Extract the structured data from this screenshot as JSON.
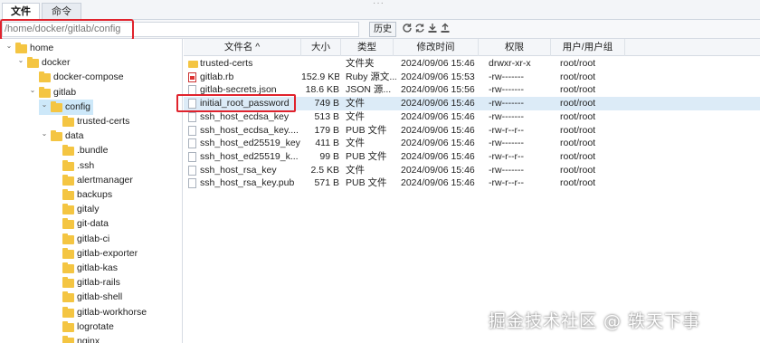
{
  "tabs": [
    {
      "label": "文件",
      "active": true
    },
    {
      "label": "命令",
      "active": false
    }
  ],
  "top_dots": "···",
  "pathbar": {
    "path": "/home/docker/gitlab/config",
    "history_label": "历史",
    "icons": [
      "refresh-icon",
      "sync-icon",
      "download-icon",
      "upload-icon"
    ]
  },
  "tree": [
    {
      "label": "home",
      "level": 0,
      "expanded": true,
      "selected": false
    },
    {
      "label": "docker",
      "level": 1,
      "expanded": true,
      "selected": false
    },
    {
      "label": "docker-compose",
      "level": 2,
      "expanded": false,
      "selected": false
    },
    {
      "label": "gitlab",
      "level": 2,
      "expanded": true,
      "selected": false
    },
    {
      "label": "config",
      "level": 3,
      "expanded": true,
      "selected": true
    },
    {
      "label": "trusted-certs",
      "level": 4,
      "expanded": false,
      "selected": false
    },
    {
      "label": "data",
      "level": 3,
      "expanded": true,
      "selected": false
    },
    {
      "label": ".bundle",
      "level": 4,
      "expanded": false,
      "selected": false
    },
    {
      "label": ".ssh",
      "level": 4,
      "expanded": false,
      "selected": false
    },
    {
      "label": "alertmanager",
      "level": 4,
      "expanded": false,
      "selected": false
    },
    {
      "label": "backups",
      "level": 4,
      "expanded": false,
      "selected": false
    },
    {
      "label": "gitaly",
      "level": 4,
      "expanded": false,
      "selected": false
    },
    {
      "label": "git-data",
      "level": 4,
      "expanded": false,
      "selected": false
    },
    {
      "label": "gitlab-ci",
      "level": 4,
      "expanded": false,
      "selected": false
    },
    {
      "label": "gitlab-exporter",
      "level": 4,
      "expanded": false,
      "selected": false
    },
    {
      "label": "gitlab-kas",
      "level": 4,
      "expanded": false,
      "selected": false
    },
    {
      "label": "gitlab-rails",
      "level": 4,
      "expanded": false,
      "selected": false
    },
    {
      "label": "gitlab-shell",
      "level": 4,
      "expanded": false,
      "selected": false
    },
    {
      "label": "gitlab-workhorse",
      "level": 4,
      "expanded": false,
      "selected": false
    },
    {
      "label": "logrotate",
      "level": 4,
      "expanded": false,
      "selected": false
    },
    {
      "label": "nginx",
      "level": 4,
      "expanded": false,
      "selected": false
    }
  ],
  "columns": {
    "name": "文件名 ^",
    "size": "大小",
    "type": "类型",
    "time": "修改时间",
    "perm": "权限",
    "owner": "用户/用户组"
  },
  "files": [
    {
      "name": "trusted-certs",
      "size": "",
      "type": "文件夹",
      "time": "2024/09/06 15:46",
      "perm": "drwxr-xr-x",
      "owner": "root/root",
      "icon": "folder"
    },
    {
      "name": "gitlab.rb",
      "size": "152.9 KB",
      "type": "Ruby 源文...",
      "time": "2024/09/06 15:53",
      "perm": "-rw-------",
      "owner": "root/root",
      "icon": "ruby"
    },
    {
      "name": "gitlab-secrets.json",
      "size": "18.6 KB",
      "type": "JSON 源...",
      "time": "2024/09/06 15:56",
      "perm": "-rw-------",
      "owner": "root/root",
      "icon": "doc"
    },
    {
      "name": "initial_root_password",
      "size": "749 B",
      "type": "文件",
      "time": "2024/09/06 15:46",
      "perm": "-rw-------",
      "owner": "root/root",
      "icon": "doc"
    },
    {
      "name": "ssh_host_ecdsa_key",
      "size": "513 B",
      "type": "文件",
      "time": "2024/09/06 15:46",
      "perm": "-rw-------",
      "owner": "root/root",
      "icon": "doc"
    },
    {
      "name": "ssh_host_ecdsa_key....",
      "size": "179 B",
      "type": "PUB 文件",
      "time": "2024/09/06 15:46",
      "perm": "-rw-r--r--",
      "owner": "root/root",
      "icon": "doc"
    },
    {
      "name": "ssh_host_ed25519_key",
      "size": "411 B",
      "type": "文件",
      "time": "2024/09/06 15:46",
      "perm": "-rw-------",
      "owner": "root/root",
      "icon": "doc"
    },
    {
      "name": "ssh_host_ed25519_k...",
      "size": "99 B",
      "type": "PUB 文件",
      "time": "2024/09/06 15:46",
      "perm": "-rw-r--r--",
      "owner": "root/root",
      "icon": "doc"
    },
    {
      "name": "ssh_host_rsa_key",
      "size": "2.5 KB",
      "type": "文件",
      "time": "2024/09/06 15:46",
      "perm": "-rw-------",
      "owner": "root/root",
      "icon": "doc"
    },
    {
      "name": "ssh_host_rsa_key.pub",
      "size": "571 B",
      "type": "PUB 文件",
      "time": "2024/09/06 15:46",
      "perm": "-rw-r--r--",
      "owner": "root/root",
      "icon": "doc"
    }
  ],
  "watermark": "掘金技术社区 @ 轶天下事"
}
